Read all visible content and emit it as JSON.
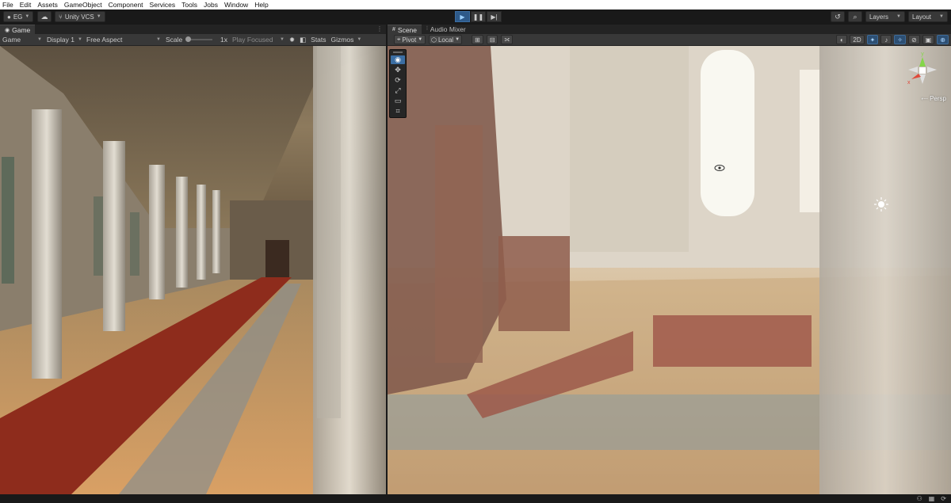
{
  "menu": [
    "File",
    "Edit",
    "Assets",
    "GameObject",
    "Component",
    "Services",
    "Tools",
    "Jobs",
    "Window",
    "Help"
  ],
  "toolbar": {
    "account": "EG",
    "vcs": "Unity VCS",
    "layers": "Layers",
    "layout": "Layout"
  },
  "game": {
    "tab_label": "Game",
    "view_mode": "Game",
    "display": "Display 1",
    "aspect": "Free Aspect",
    "scale_label": "Scale",
    "scale_value": "1x",
    "play_mode": "Play Focused",
    "stats": "Stats",
    "gizmos": "Gizmos"
  },
  "scene": {
    "tabs": [
      "Scene",
      "Audio Mixer"
    ],
    "pivot": "Pivot",
    "local": "Local",
    "mode_2d": "2D",
    "persp": "Persp",
    "gizmo_axes": [
      "y",
      "x",
      "z"
    ]
  },
  "colors": {
    "accent": "#3b6ea3",
    "menubar": "#ffffff",
    "panel": "#383838",
    "play_active": "#2e5a8a",
    "gizmo_x": "#e0493a",
    "gizmo_y": "#84d64a",
    "gizmo_z": "#3a79e0"
  }
}
